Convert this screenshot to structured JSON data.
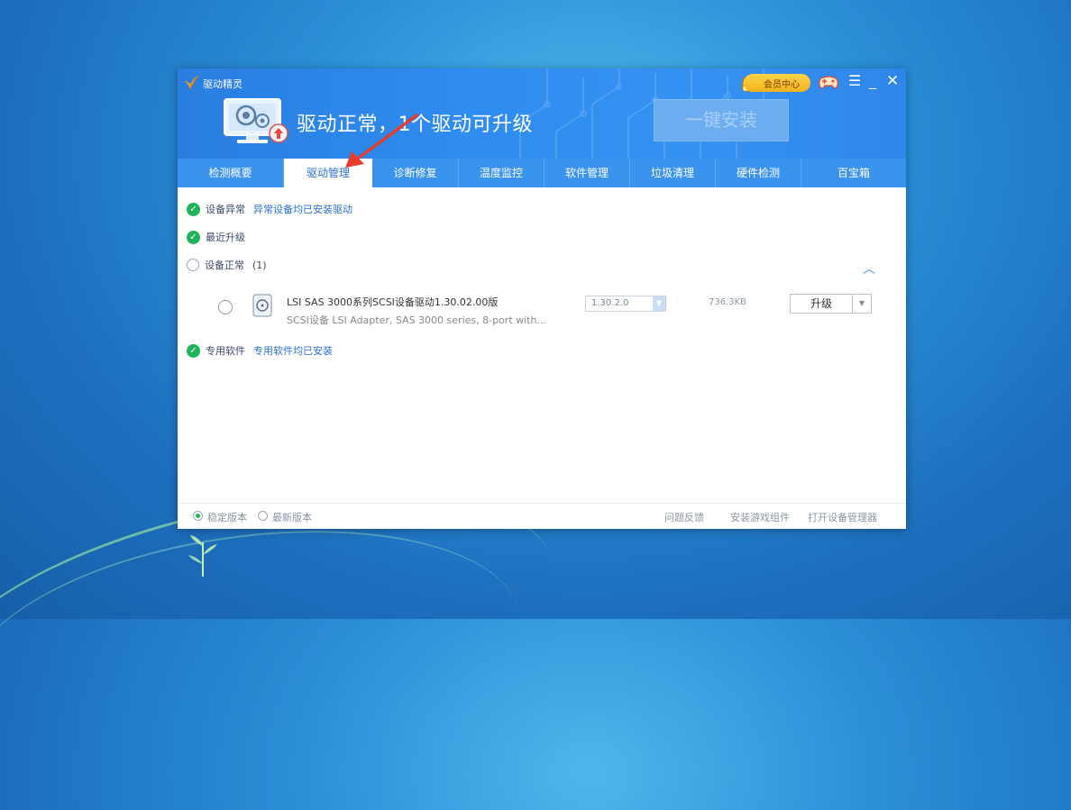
{
  "app": {
    "name": "驱动精灵",
    "status": "驱动正常，1个驱动可升级",
    "install_button": "一键安装",
    "vip_label": "会员中心",
    "vip_badge": "VIP",
    "menu_symbol": "☰",
    "minimize_symbol": "_",
    "close_symbol": "✕"
  },
  "tabs": [
    {
      "label": "检测概要"
    },
    {
      "label": "驱动管理"
    },
    {
      "label": "诊断修复"
    },
    {
      "label": "温度监控"
    },
    {
      "label": "软件管理"
    },
    {
      "label": "垃圾清理"
    },
    {
      "label": "硬件检测"
    },
    {
      "label": "百宝箱"
    }
  ],
  "sections": {
    "abnormal": {
      "title": "设备异常",
      "note": "异常设备均已安装驱动"
    },
    "recent": {
      "title": "最近升级"
    },
    "normal": {
      "title": "设备正常",
      "count": "(1)"
    },
    "special": {
      "title": "专用软件",
      "note": "专用软件均已安装"
    }
  },
  "driver": {
    "name": "LSI SAS 3000系列SCSI设备驱动1.30.02.00版",
    "desc": "SCSI设备    LSI Adapter, SAS 3000 series, 8-port with...",
    "version": "1.30.2.0",
    "size": "736.3KB",
    "action": "升级"
  },
  "footer": {
    "stable": "稳定版本",
    "latest": "最新版本",
    "feedback": "问题反馈",
    "install_game": "安装游戏组件",
    "open_device_manager": "打开设备管理器"
  },
  "colors": {
    "header_blue": "#2f86ea",
    "tab_bar": "#3a94ee",
    "active_tab_text": "#2a6fcf",
    "check_green": "#1fb35a",
    "annotation_arrow": "#e83a2e"
  }
}
